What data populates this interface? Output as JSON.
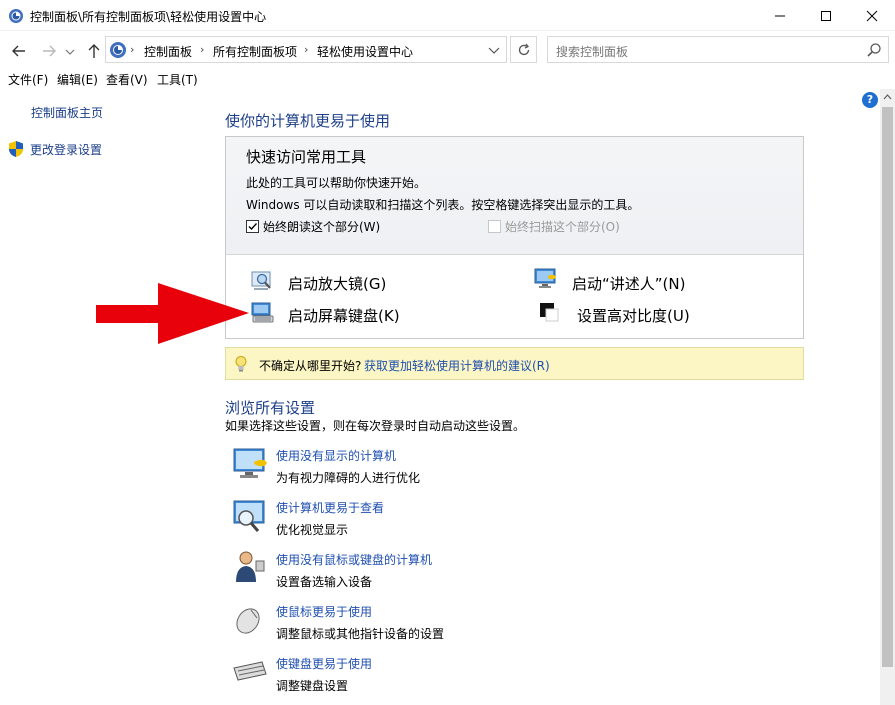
{
  "window": {
    "title": "控制面板\\所有控制面板项\\轻松使用设置中心",
    "controls": {
      "minimize": "minimize-icon",
      "maximize": "maximize-icon",
      "close": "close-icon"
    }
  },
  "address": {
    "crumbs": [
      "控制面板",
      "所有控制面板项",
      "轻松使用设置中心"
    ],
    "search_placeholder": "搜索控制面板"
  },
  "menu": [
    "文件(F)",
    "编辑(E)",
    "查看(V)",
    "工具(T)"
  ],
  "left_nav": {
    "home": "控制面板主页",
    "login": "更改登录设置"
  },
  "main": {
    "heading": "使你的计算机更易于使用",
    "quick": {
      "title": "快速访问常用工具",
      "line1": "此处的工具可以帮助你快速开始。",
      "line2": "Windows 可以自动读取和扫描这个列表。按空格键选择突出显示的工具。",
      "read_aloud": "始终朗读这个部分(W)",
      "read_aloud_checked": true,
      "scan": "始终扫描这个部分(O)",
      "scan_checked": false
    },
    "tools": {
      "magnifier": "启动放大镜(G)",
      "narrator": "启动“讲述人”(N)",
      "osk": "启动屏幕键盘(K)",
      "contrast": "设置高对比度(U)"
    },
    "tip": {
      "text": "不确定从哪里开始?",
      "link": "获取更加轻松使用计算机的建议(R)"
    },
    "browse": {
      "heading": "浏览所有设置",
      "sub": "如果选择这些设置，则在每次登录时自动启动这些设置。",
      "items": [
        {
          "link": "使用没有显示的计算机",
          "desc": "为有视力障碍的人进行优化",
          "icon": "display-off-icon"
        },
        {
          "link": "使计算机更易于查看",
          "desc": "优化视觉显示",
          "icon": "monitor-magnifier-icon"
        },
        {
          "link": "使用没有鼠标或键盘的计算机",
          "desc": "设置备选输入设备",
          "icon": "user-speech-icon"
        },
        {
          "link": "使鼠标更易于使用",
          "desc": "调整鼠标或其他指针设备的设置",
          "icon": "mouse-icon"
        },
        {
          "link": "使键盘更易于使用",
          "desc": "调整键盘设置",
          "icon": "keyboard-icon"
        }
      ]
    }
  },
  "colors": {
    "accent_link": "#1f4fb0",
    "heading": "#1e3f8a",
    "tip_bg": "#fbf6c4",
    "arrow": "#e8000b"
  }
}
